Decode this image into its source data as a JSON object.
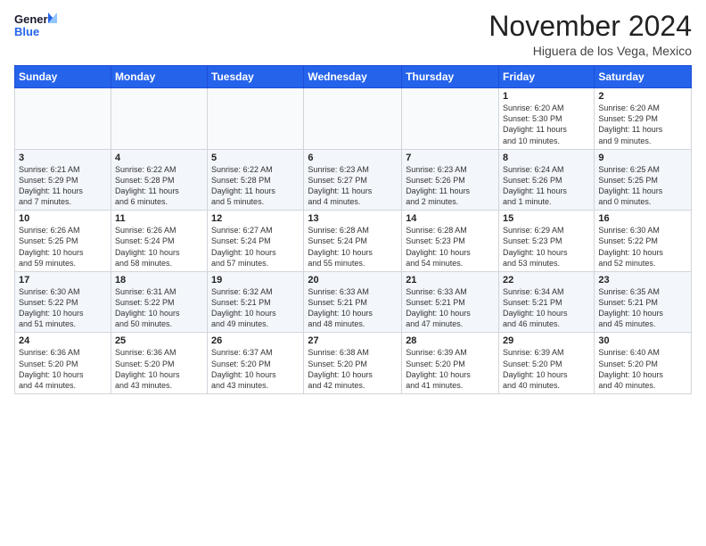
{
  "logo": {
    "line1": "General",
    "line2": "Blue"
  },
  "title": "November 2024",
  "location": "Higuera de los Vega, Mexico",
  "days_header": [
    "Sunday",
    "Monday",
    "Tuesday",
    "Wednesday",
    "Thursday",
    "Friday",
    "Saturday"
  ],
  "weeks": [
    [
      {
        "day": "",
        "info": ""
      },
      {
        "day": "",
        "info": ""
      },
      {
        "day": "",
        "info": ""
      },
      {
        "day": "",
        "info": ""
      },
      {
        "day": "",
        "info": ""
      },
      {
        "day": "1",
        "info": "Sunrise: 6:20 AM\nSunset: 5:30 PM\nDaylight: 11 hours\nand 10 minutes."
      },
      {
        "day": "2",
        "info": "Sunrise: 6:20 AM\nSunset: 5:29 PM\nDaylight: 11 hours\nand 9 minutes."
      }
    ],
    [
      {
        "day": "3",
        "info": "Sunrise: 6:21 AM\nSunset: 5:29 PM\nDaylight: 11 hours\nand 7 minutes."
      },
      {
        "day": "4",
        "info": "Sunrise: 6:22 AM\nSunset: 5:28 PM\nDaylight: 11 hours\nand 6 minutes."
      },
      {
        "day": "5",
        "info": "Sunrise: 6:22 AM\nSunset: 5:28 PM\nDaylight: 11 hours\nand 5 minutes."
      },
      {
        "day": "6",
        "info": "Sunrise: 6:23 AM\nSunset: 5:27 PM\nDaylight: 11 hours\nand 4 minutes."
      },
      {
        "day": "7",
        "info": "Sunrise: 6:23 AM\nSunset: 5:26 PM\nDaylight: 11 hours\nand 2 minutes."
      },
      {
        "day": "8",
        "info": "Sunrise: 6:24 AM\nSunset: 5:26 PM\nDaylight: 11 hours\nand 1 minute."
      },
      {
        "day": "9",
        "info": "Sunrise: 6:25 AM\nSunset: 5:25 PM\nDaylight: 11 hours\nand 0 minutes."
      }
    ],
    [
      {
        "day": "10",
        "info": "Sunrise: 6:26 AM\nSunset: 5:25 PM\nDaylight: 10 hours\nand 59 minutes."
      },
      {
        "day": "11",
        "info": "Sunrise: 6:26 AM\nSunset: 5:24 PM\nDaylight: 10 hours\nand 58 minutes."
      },
      {
        "day": "12",
        "info": "Sunrise: 6:27 AM\nSunset: 5:24 PM\nDaylight: 10 hours\nand 57 minutes."
      },
      {
        "day": "13",
        "info": "Sunrise: 6:28 AM\nSunset: 5:24 PM\nDaylight: 10 hours\nand 55 minutes."
      },
      {
        "day": "14",
        "info": "Sunrise: 6:28 AM\nSunset: 5:23 PM\nDaylight: 10 hours\nand 54 minutes."
      },
      {
        "day": "15",
        "info": "Sunrise: 6:29 AM\nSunset: 5:23 PM\nDaylight: 10 hours\nand 53 minutes."
      },
      {
        "day": "16",
        "info": "Sunrise: 6:30 AM\nSunset: 5:22 PM\nDaylight: 10 hours\nand 52 minutes."
      }
    ],
    [
      {
        "day": "17",
        "info": "Sunrise: 6:30 AM\nSunset: 5:22 PM\nDaylight: 10 hours\nand 51 minutes."
      },
      {
        "day": "18",
        "info": "Sunrise: 6:31 AM\nSunset: 5:22 PM\nDaylight: 10 hours\nand 50 minutes."
      },
      {
        "day": "19",
        "info": "Sunrise: 6:32 AM\nSunset: 5:21 PM\nDaylight: 10 hours\nand 49 minutes."
      },
      {
        "day": "20",
        "info": "Sunrise: 6:33 AM\nSunset: 5:21 PM\nDaylight: 10 hours\nand 48 minutes."
      },
      {
        "day": "21",
        "info": "Sunrise: 6:33 AM\nSunset: 5:21 PM\nDaylight: 10 hours\nand 47 minutes."
      },
      {
        "day": "22",
        "info": "Sunrise: 6:34 AM\nSunset: 5:21 PM\nDaylight: 10 hours\nand 46 minutes."
      },
      {
        "day": "23",
        "info": "Sunrise: 6:35 AM\nSunset: 5:21 PM\nDaylight: 10 hours\nand 45 minutes."
      }
    ],
    [
      {
        "day": "24",
        "info": "Sunrise: 6:36 AM\nSunset: 5:20 PM\nDaylight: 10 hours\nand 44 minutes."
      },
      {
        "day": "25",
        "info": "Sunrise: 6:36 AM\nSunset: 5:20 PM\nDaylight: 10 hours\nand 43 minutes."
      },
      {
        "day": "26",
        "info": "Sunrise: 6:37 AM\nSunset: 5:20 PM\nDaylight: 10 hours\nand 43 minutes."
      },
      {
        "day": "27",
        "info": "Sunrise: 6:38 AM\nSunset: 5:20 PM\nDaylight: 10 hours\nand 42 minutes."
      },
      {
        "day": "28",
        "info": "Sunrise: 6:39 AM\nSunset: 5:20 PM\nDaylight: 10 hours\nand 41 minutes."
      },
      {
        "day": "29",
        "info": "Sunrise: 6:39 AM\nSunset: 5:20 PM\nDaylight: 10 hours\nand 40 minutes."
      },
      {
        "day": "30",
        "info": "Sunrise: 6:40 AM\nSunset: 5:20 PM\nDaylight: 10 hours\nand 40 minutes."
      }
    ]
  ]
}
